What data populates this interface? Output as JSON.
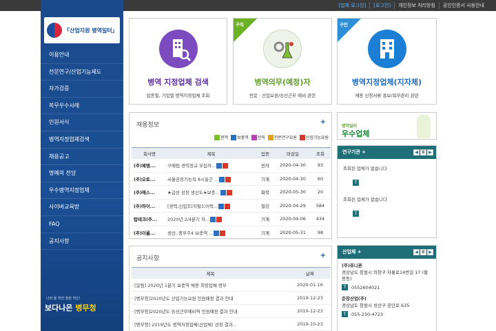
{
  "topbar": {
    "login_corp": "[업체 로그인]",
    "login_personal": "[로그인]",
    "links": [
      "개인정보 처리방침",
      "공인인증서 사용안내"
    ]
  },
  "sidebar": {
    "logo_text": "「산업지원 병역일터」",
    "menu": [
      "이용안내",
      "전문연구/산업기능제도",
      "자가검증",
      "복무우수사례",
      "민원서식",
      "병역지정업체검색",
      "채용공고",
      "명예의 전당",
      "우수병역지정업체",
      "사이버교육방",
      "FAQ",
      "공지사항"
    ],
    "bottom_tag": "나와 둘 위한 참된 혁신!",
    "slogan_a": "보다나은 ",
    "slogan_b": "병무청"
  },
  "cards": [
    {
      "title": "병역 지정업체 검색",
      "sub": "업종별, 기업별 병역지정업체 조회",
      "ribbon": ""
    },
    {
      "title": "병역의무(예정)자",
      "sub": "전문 · 산업요원/승선근무 예비 관련",
      "ribbon": "구직"
    },
    {
      "title": "병역지정업체(지자체)",
      "sub": "채용 신청서류 홍보/복무관리 관련",
      "ribbon": "구인"
    }
  ],
  "recruit": {
    "title": "채용정보",
    "more": "+",
    "legend": [
      {
        "label": "현역",
        "color": "#7bbf2a"
      },
      {
        "label": "보충역",
        "color": "#2f6fbf"
      },
      {
        "label": "전직",
        "color": "#b844b0"
      },
      {
        "label": "전문연구요원",
        "color": "#e0a020"
      },
      {
        "label": "산업기능요원",
        "color": "#d33a2c"
      }
    ],
    "headers": [
      "회사명",
      "제목",
      "업종",
      "마감일",
      "조회"
    ],
    "rows": [
      {
        "company": "(주)제엠...",
        "title": "구매팀 경력정규 모집하...",
        "badges": [
          "#2f6fbf",
          "#d33a2c"
        ],
        "industry": "전자",
        "deadline": "2020-04-30",
        "views": "93"
      },
      {
        "company": "(주)오토...",
        "title": "서울공장기능직 8시출근 ...",
        "badges": [
          "#2f6fbf",
          "#d33a2c"
        ],
        "industry": "기계",
        "deadline": "2020-04-30",
        "views": "60"
      },
      {
        "company": "(주)에스...",
        "title": "★급성 성장 생산도★보충...",
        "badges": [
          "#2f6fbf",
          "#d33a2c"
        ],
        "industry": "화학",
        "deadline": "2020-05-30",
        "views": "20"
      },
      {
        "company": "(주)하이...",
        "title": "[경력,신입]디지털드어락...",
        "badges": [
          "#2f6fbf",
          "#d33a2c"
        ],
        "industry": "철강",
        "deadline": "2020-04-29",
        "views": "584"
      },
      {
        "company": "탑테크(주...",
        "title": "2020년 2/4분기 차...",
        "badges": [
          "#2f6fbf",
          "#d33a2c"
        ],
        "industry": "기계",
        "deadline": "2020-04-06",
        "views": "434"
      },
      {
        "company": "(주)이룸...",
        "title": "생산, 중후주4 보충역 ...",
        "badges": [
          "#2f6fbf",
          "#d33a2c"
        ],
        "industry": "기계",
        "deadline": "2020-05-31",
        "views": "98"
      }
    ]
  },
  "notice": {
    "title": "공지사항",
    "more": "+",
    "headers": [
      "제목",
      "날짜"
    ],
    "rows": [
      {
        "title": "· [알림] 2020년 1분기 보충역 채용 희망업체 명부",
        "date": "2020-01-16"
      },
      {
        "title": "· [병무청]2020년도 산업기능요원 인원배정 결과 안내",
        "date": "2019-12-23"
      },
      {
        "title": "· [병무청]2020년도 승선근무예비역 인원배정 결과 안내",
        "date": "2019-12-23"
      },
      {
        "title": "· [병무청] 2019년도 병역지정업체(산업체) 선정 결과...",
        "date": "2019-10-23"
      }
    ]
  },
  "banner": {
    "small": "병역일터",
    "big": "우수업체"
  },
  "institutions": {
    "title": "연구기관 +",
    "items": [
      {
        "text": "조회된 업체가 없습니다",
        "icon": "T"
      },
      {
        "text": "조회된 업체가 없습니다",
        "icon": "T"
      }
    ]
  },
  "corporations": {
    "title": "산업체 +",
    "items": [
      {
        "name": "(주)쥬니폰",
        "addr": "경상남도 창원시 의창구 차룡로14번길 17 (팔용동)",
        "tel": "0552604021"
      },
      {
        "name": "준창산업(주)",
        "addr": "경상남도 창원시 성산구 공단로 635",
        "tel": "055-230-4723"
      }
    ]
  }
}
